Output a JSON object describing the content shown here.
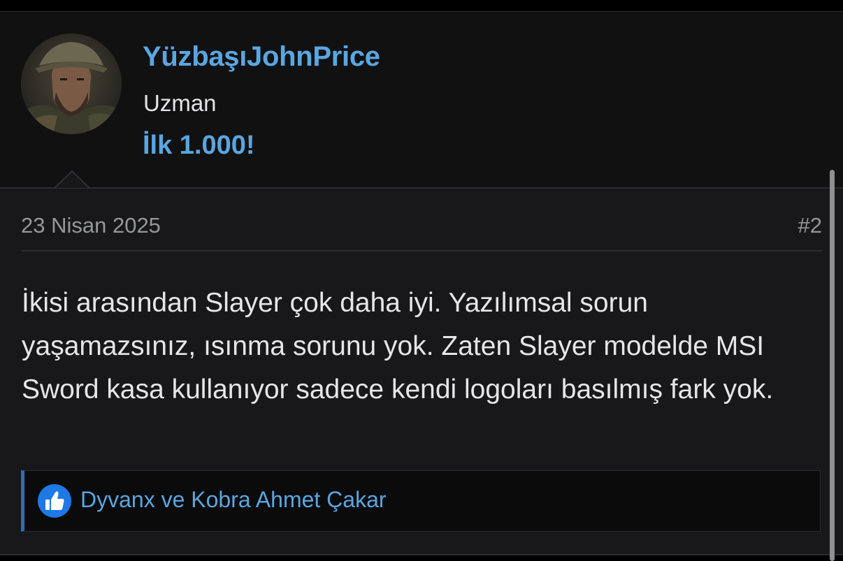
{
  "user": {
    "username": "YüzbaşıJohnPrice",
    "title": "Uzman",
    "banner": "İlk 1.000!",
    "avatar_icon": "user-avatar-image"
  },
  "post": {
    "date": "23 Nisan 2025",
    "number": "#2",
    "body": "İkisi arasından Slayer çok daha iyi. Yazılımsal sorun yaşamazsınız, ısınma sorunu yok. Zaten Slayer modelde MSI Sword kasa kullanıyor sadece kendi logoları basılmış fark yok."
  },
  "reactions": {
    "icon": "thumbs-up-icon",
    "text": "Dyvanx ve Kobra Ahmet Çakar"
  },
  "colors": {
    "link_blue": "#5aa6e0",
    "background": "#18181a",
    "header_background": "#111112",
    "reaction_accent": "#2c6fb6"
  }
}
